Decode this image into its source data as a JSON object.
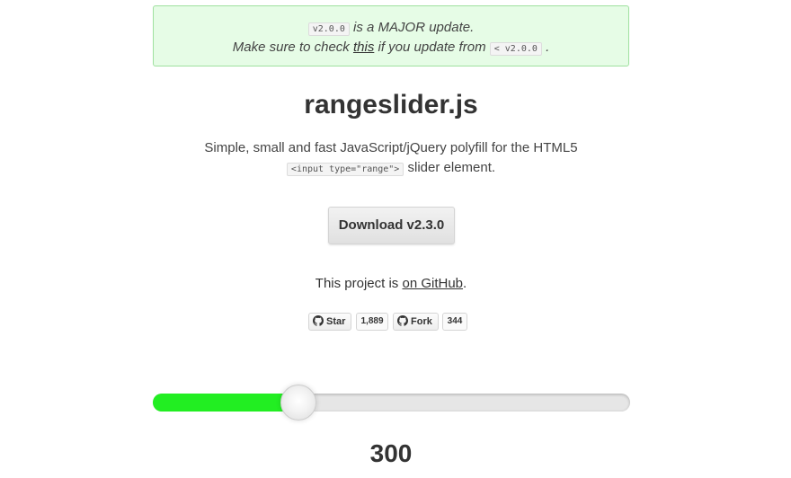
{
  "notice": {
    "version_code": "v2.0.0",
    "line1_text": " is a MAJOR update.",
    "line2_prefix": "Make sure to check ",
    "link_label": "this",
    "line2_middle": " if you update from ",
    "old_version_code": "< v2.0.0",
    "line2_suffix": " ."
  },
  "title": "rangeslider.js",
  "description": {
    "line1": "Simple, small and fast JavaScript/jQuery polyfill for the HTML5",
    "code": "<input type=\"range\">",
    "line2_suffix": " slider element."
  },
  "download_label": "Download v2.3.0",
  "github": {
    "prefix": "This project is ",
    "link_label": "on GitHub",
    "suffix": ".",
    "star_label": "Star",
    "star_count": "1,889",
    "fork_label": "Fork",
    "fork_count": "344",
    "icon": "github-mark-icon"
  },
  "slider": {
    "value": 300,
    "fraction": 0.306,
    "fill_color": "#22ee22",
    "track_color": "#e6e6e6"
  },
  "output_value": "300"
}
